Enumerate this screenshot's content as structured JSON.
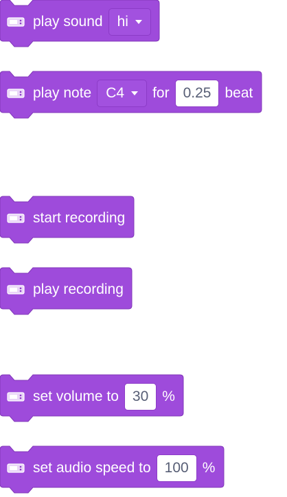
{
  "colors": {
    "block_fill": "#9e4bdb",
    "block_stroke": "#8137b9",
    "field_fill": "#a251df",
    "text": "#ffffff",
    "number_text": "#575e75"
  },
  "icon": "speaker-board-icon",
  "blocks": [
    {
      "id": "play-sound",
      "parts": [
        {
          "t": "text",
          "v": "play sound"
        },
        {
          "t": "dropdown",
          "v": "hi"
        }
      ]
    },
    {
      "id": "play-note",
      "parts": [
        {
          "t": "text",
          "v": "play note"
        },
        {
          "t": "dropdown",
          "v": "C4"
        },
        {
          "t": "text",
          "v": "for"
        },
        {
          "t": "number",
          "v": "0.25"
        },
        {
          "t": "text",
          "v": "beat"
        }
      ]
    },
    {
      "id": "start-recording",
      "parts": [
        {
          "t": "text",
          "v": "start recording"
        }
      ]
    },
    {
      "id": "play-recording",
      "parts": [
        {
          "t": "text",
          "v": "play recording"
        }
      ]
    },
    {
      "id": "set-volume",
      "parts": [
        {
          "t": "text",
          "v": "set volume to"
        },
        {
          "t": "number",
          "v": "30"
        },
        {
          "t": "text",
          "v": "%"
        }
      ]
    },
    {
      "id": "set-audio-speed",
      "parts": [
        {
          "t": "text",
          "v": "set audio speed to"
        },
        {
          "t": "number",
          "v": "100"
        },
        {
          "t": "text",
          "v": "%"
        }
      ]
    }
  ]
}
